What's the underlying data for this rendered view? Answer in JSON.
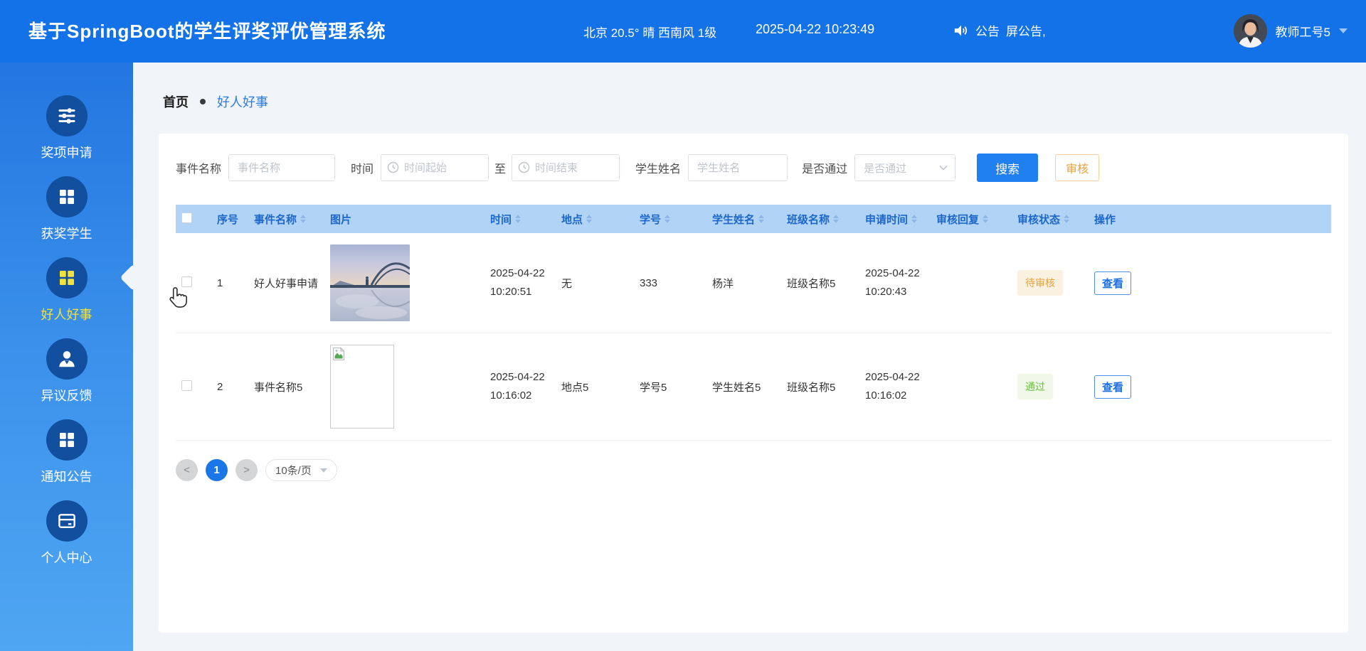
{
  "header": {
    "title": "基于SpringBoot的学生评奖评优管理系统",
    "weather": "北京 20.5° 晴 西南风 1级",
    "datetime": "2025-04-22 10:23:49",
    "announce_label": "公告",
    "announce_text": "屏公告,",
    "user_name": "教师工号5"
  },
  "sidebar": {
    "items": [
      {
        "label": "奖项申请",
        "icon": "sliders-icon",
        "active": false
      },
      {
        "label": "获奖学生",
        "icon": "grid-icon",
        "active": false
      },
      {
        "label": "好人好事",
        "icon": "grid-icon",
        "active": true
      },
      {
        "label": "异议反馈",
        "icon": "user-icon",
        "active": false
      },
      {
        "label": "通知公告",
        "icon": "grid-icon",
        "active": false
      },
      {
        "label": "个人中心",
        "icon": "card-icon",
        "active": false
      }
    ]
  },
  "breadcrumb": {
    "home": "首页",
    "current": "好人好事"
  },
  "filters": {
    "event_label": "事件名称",
    "event_placeholder": "事件名称",
    "time_label": "时间",
    "time_start_placeholder": "时间起始",
    "to_label": "至",
    "time_end_placeholder": "时间结束",
    "student_label": "学生姓名",
    "student_placeholder": "学生姓名",
    "pass_label": "是否通过",
    "pass_placeholder": "是否通过",
    "search_button": "搜索",
    "review_button": "审核"
  },
  "table": {
    "columns": [
      {
        "key": "index",
        "label": "序号",
        "sortable": false
      },
      {
        "key": "event-name",
        "label": "事件名称",
        "sortable": true
      },
      {
        "key": "image",
        "label": "图片",
        "sortable": false
      },
      {
        "key": "time",
        "label": "时间",
        "sortable": true
      },
      {
        "key": "location",
        "label": "地点",
        "sortable": true
      },
      {
        "key": "student-no",
        "label": "学号",
        "sortable": true
      },
      {
        "key": "student-name",
        "label": "学生姓名",
        "sortable": true
      },
      {
        "key": "class-name",
        "label": "班级名称",
        "sortable": true
      },
      {
        "key": "apply-time",
        "label": "申请时间",
        "sortable": true
      },
      {
        "key": "review-reply",
        "label": "审核回复",
        "sortable": true
      },
      {
        "key": "review-status",
        "label": "审核状态",
        "sortable": true
      },
      {
        "key": "action",
        "label": "操作",
        "sortable": false
      }
    ],
    "rows": [
      {
        "index": "1",
        "event_name": "好人好事申请",
        "image": "bridge-photo",
        "time": "2025-04-22 10:20:51",
        "location": "无",
        "student_no": "333",
        "student_name": "杨洋",
        "class_name": "班级名称5",
        "apply_time": "2025-04-22 10:20:43",
        "review_reply": "",
        "status": "待审核",
        "status_type": "pending",
        "action": "查看"
      },
      {
        "index": "2",
        "event_name": "事件名称5",
        "image": "broken-image",
        "time": "2025-04-22 10:16:02",
        "location": "地点5",
        "student_no": "学号5",
        "student_name": "学生姓名5",
        "class_name": "班级名称5",
        "apply_time": "2025-04-22 10:16:02",
        "review_reply": "",
        "status": "通过",
        "status_type": "passed",
        "action": "查看"
      }
    ]
  },
  "pagination": {
    "prev": "<",
    "page": "1",
    "next": ">",
    "page_size": "10条/页"
  },
  "colors": {
    "header_bg": "#1372E8",
    "sidebar_icon_bg": "#124F9E",
    "active_yellow": "#F2E23C",
    "table_header_bg": "#B1D3F5",
    "table_header_text": "#1C67C9",
    "primary": "#2080F0",
    "warning": "#E6A23C",
    "success": "#67C23A"
  }
}
